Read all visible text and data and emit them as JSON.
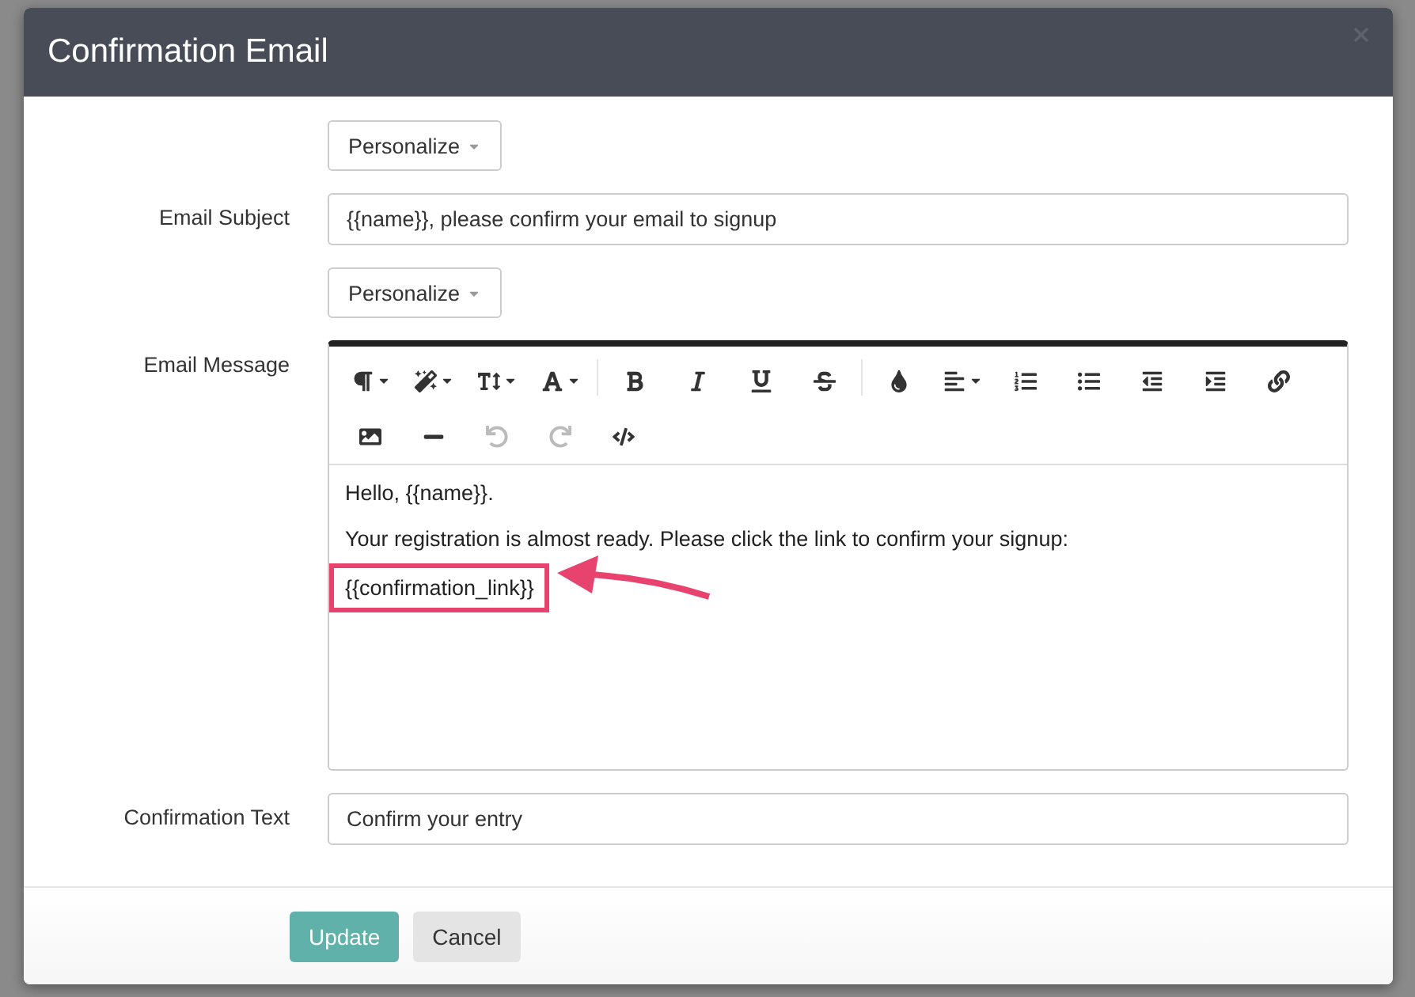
{
  "dialog": {
    "title": "Confirmation Email"
  },
  "form": {
    "subject_personalize": "Personalize",
    "subject_label": "Email Subject",
    "subject_value": "{{name}}, please confirm your email to signup",
    "message_personalize": "Personalize",
    "message_label": "Email Message",
    "toolbar": [
      [
        {
          "kind": "paragraph",
          "menu": true,
          "disabled": false
        },
        {
          "kind": "magic",
          "menu": true,
          "disabled": false
        },
        {
          "kind": "size",
          "menu": true,
          "disabled": false
        },
        {
          "kind": "font",
          "menu": true,
          "disabled": false
        }
      ],
      [
        {
          "kind": "bold",
          "menu": false,
          "disabled": false
        },
        {
          "kind": "italic",
          "menu": false,
          "disabled": false
        },
        {
          "kind": "underline",
          "menu": false,
          "disabled": false
        },
        {
          "kind": "strike",
          "menu": false,
          "disabled": false
        }
      ],
      [
        {
          "kind": "color",
          "menu": false,
          "disabled": false
        },
        {
          "kind": "align",
          "menu": true,
          "disabled": false
        },
        {
          "kind": "ordered",
          "menu": false,
          "disabled": false
        },
        {
          "kind": "unordered",
          "menu": false,
          "disabled": false
        },
        {
          "kind": "outdent",
          "menu": false,
          "disabled": false
        },
        {
          "kind": "indent",
          "menu": false,
          "disabled": false
        },
        {
          "kind": "link",
          "menu": false,
          "disabled": false
        },
        {
          "kind": "image",
          "menu": false,
          "disabled": false
        },
        {
          "kind": "rule",
          "menu": false,
          "disabled": false
        },
        {
          "kind": "undo",
          "menu": false,
          "disabled": true
        },
        {
          "kind": "redo",
          "menu": false,
          "disabled": true
        },
        {
          "kind": "code",
          "menu": false,
          "disabled": false
        }
      ]
    ],
    "paragraphs": [
      {
        "text": "Hello, {{name}}.",
        "highlighted": false
      },
      {
        "text": "Your registration is almost ready. Please click the link to confirm your signup:",
        "highlighted": false
      },
      {
        "text": "{{confirmation_link}}",
        "highlighted": true
      }
    ],
    "confirm_label": "Confirmation Text",
    "confirm_value": "Confirm your entry"
  },
  "buttons": [
    {
      "label": "Update",
      "kind": "primary"
    },
    {
      "label": "Cancel",
      "kind": "secondary"
    }
  ]
}
